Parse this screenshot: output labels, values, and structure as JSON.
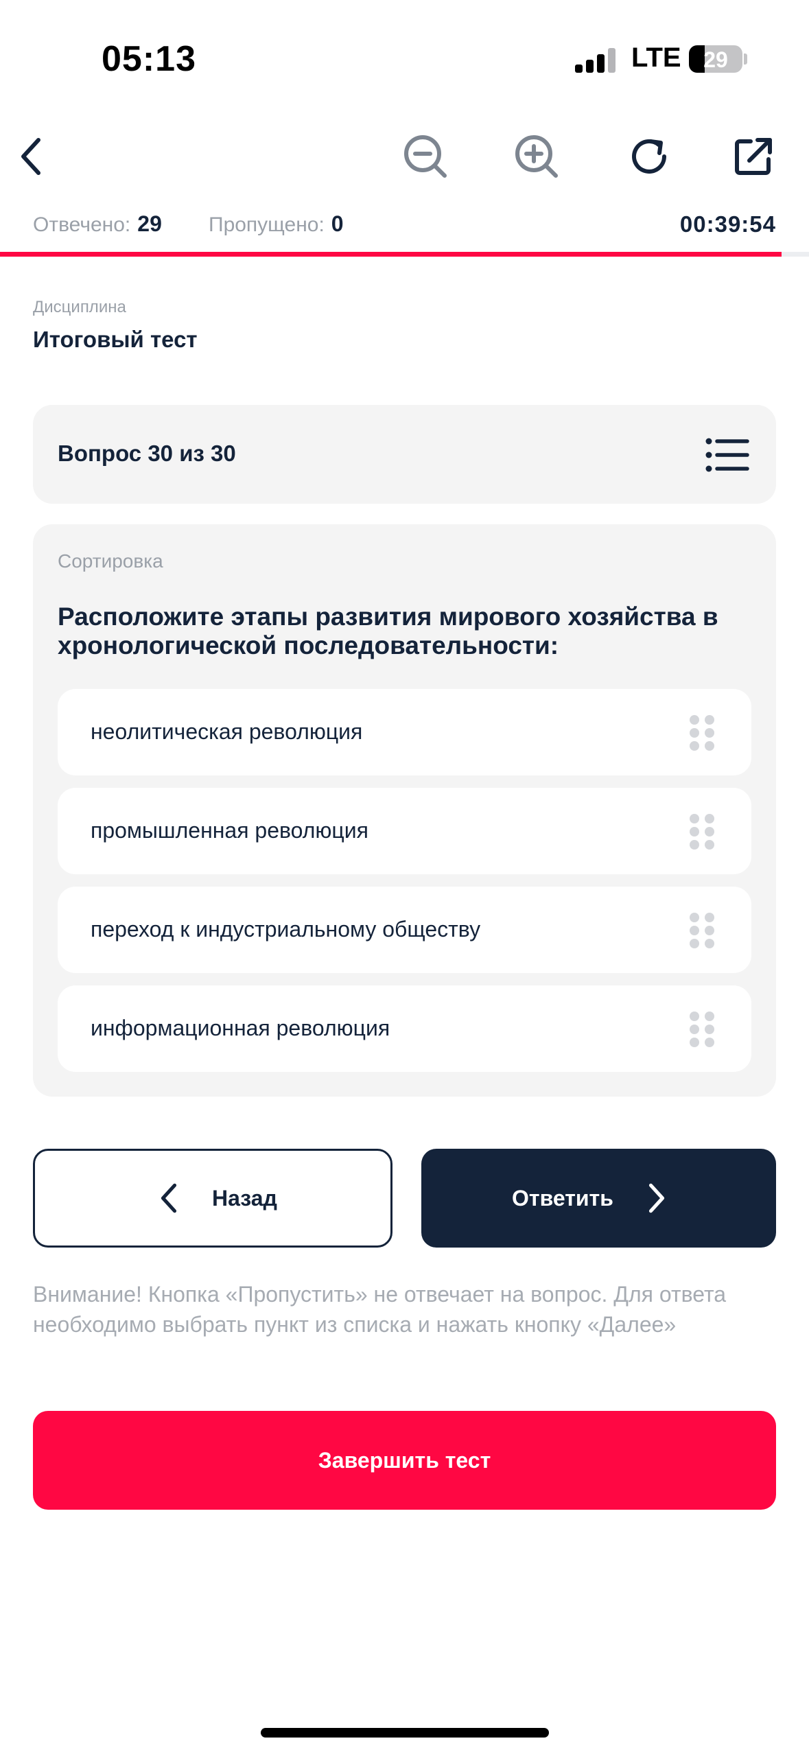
{
  "status_bar": {
    "time": "05:13",
    "network": "LTE",
    "battery": "29"
  },
  "toolbar": {
    "back_icon": "chevron-left-icon",
    "zoom_out_icon": "zoom-out-icon",
    "zoom_in_icon": "zoom-in-icon",
    "reload_icon": "reload-icon",
    "open_external_icon": "open-external-icon"
  },
  "stats": {
    "answered_label": "Отвечено:",
    "answered_value": "29",
    "skipped_label": "Пропущено:",
    "skipped_value": "0",
    "timer": "00:39:54",
    "progress_fraction": 0.966
  },
  "discipline": {
    "label": "Дисциплина",
    "value": "Итоговый тест"
  },
  "question": {
    "header": "Вопрос 30 из 30",
    "type": "Сортировка",
    "text": "Расположите этапы развития мирового хозяйства в хронологической последовательности:",
    "options": [
      "неолитическая революция",
      "промышленная революция",
      "переход к индустриальному обществу",
      "информационная революция"
    ]
  },
  "buttons": {
    "back": "Назад",
    "answer": "Ответить",
    "finish": "Завершить тест"
  },
  "notice": "Внимание! Кнопка «Пропустить» не отвечает на вопрос. Для ответа необходимо выбрать пункт из списка и нажать кнопку «Далее»",
  "colors": {
    "accent": "#ff0743",
    "dark": "#14233a",
    "card": "#f4f4f4",
    "muted": "#9aa0a8"
  }
}
